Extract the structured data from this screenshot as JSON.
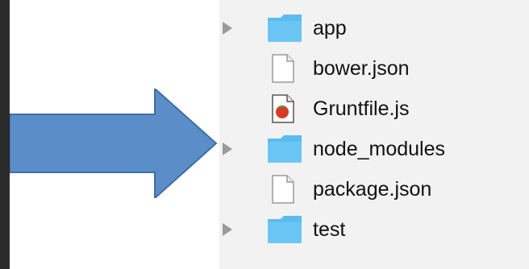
{
  "file_browser": {
    "items": [
      {
        "name": "app",
        "type": "folder",
        "icon": "folder-icon"
      },
      {
        "name": "bower.json",
        "type": "file",
        "icon": "document-icon"
      },
      {
        "name": "Gruntfile.js",
        "type": "file",
        "icon": "js-file-icon"
      },
      {
        "name": "node_modules",
        "type": "folder",
        "icon": "folder-icon"
      },
      {
        "name": "package.json",
        "type": "file",
        "icon": "document-icon"
      },
      {
        "name": "test",
        "type": "folder",
        "icon": "folder-icon"
      }
    ]
  },
  "colors": {
    "folder_blue": "#5bbcf0",
    "arrow_blue": "#5b8ec8",
    "arrow_border": "#3f6f9f"
  }
}
